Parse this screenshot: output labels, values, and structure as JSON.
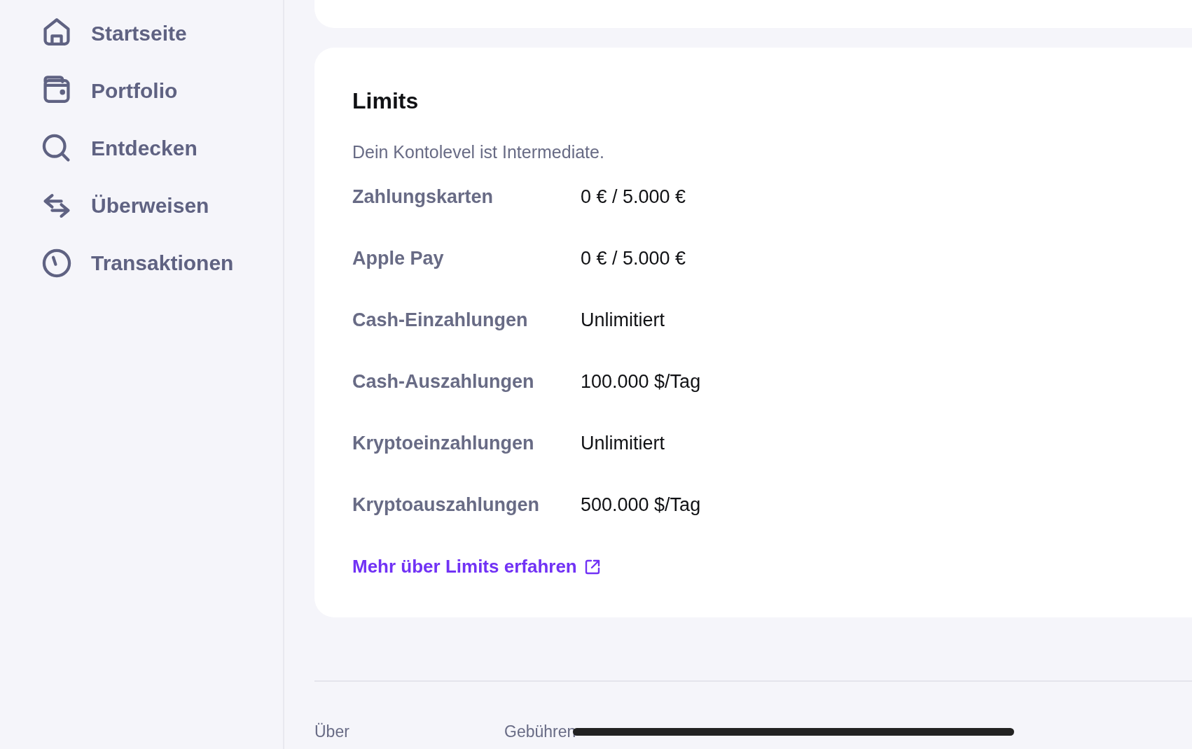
{
  "sidebar": {
    "items": [
      {
        "label": "Startseite"
      },
      {
        "label": "Portfolio"
      },
      {
        "label": "Entdecken"
      },
      {
        "label": "Überweisen"
      },
      {
        "label": "Transaktionen"
      }
    ]
  },
  "limits_card": {
    "title": "Limits",
    "subtitle": "Dein Kontolevel ist Intermediate.",
    "rows": [
      {
        "label": "Zahlungskarten",
        "value": "0 € / 5.000 €"
      },
      {
        "label": "Apple Pay",
        "value": "0 € / 5.000 €"
      },
      {
        "label": "Cash-Einzahlungen",
        "value": "Unlimitiert"
      },
      {
        "label": "Cash-Auszahlungen",
        "value": "100.000 $/Tag"
      },
      {
        "label": "Kryptoeinzahlungen",
        "value": "Unlimitiert"
      },
      {
        "label": "Kryptoauszahlungen",
        "value": "500.000 $/Tag"
      }
    ],
    "link": "Mehr über Limits erfahren"
  },
  "footer": {
    "links": [
      "Über",
      "Gebühren"
    ]
  }
}
